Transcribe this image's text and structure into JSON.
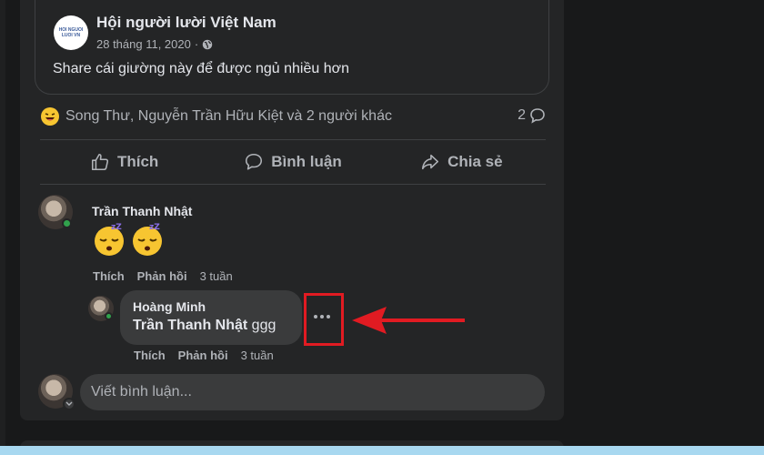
{
  "shared_post": {
    "page_name": "Hội người lười Việt Nam",
    "date": "28 tháng 11, 2020",
    "text": "Share cái giường này để được ngủ nhiều hơn"
  },
  "reactions": {
    "names": "Song Thư, Nguyễn Trần Hữu Kiệt và 2 người khác",
    "comment_count": "2"
  },
  "actions": {
    "like": "Thích",
    "comment": "Bình luận",
    "share": "Chia sẻ"
  },
  "comments": [
    {
      "author": "Trần Thanh Nhật",
      "like_label": "Thích",
      "reply_label": "Phản hồi",
      "time": "3 tuần"
    }
  ],
  "reply": {
    "author": "Hoàng Minh",
    "mention": "Trần Thanh Nhật",
    "text": " ggg",
    "like_label": "Thích",
    "reply_label": "Phản hồi",
    "time": "3 tuần"
  },
  "composer": {
    "placeholder": "Viết bình luận..."
  },
  "colors": {
    "background": "#18191a",
    "card": "#242526",
    "bubble": "#3a3b3c",
    "highlight": "#e11b22",
    "online": "#31a24c"
  }
}
